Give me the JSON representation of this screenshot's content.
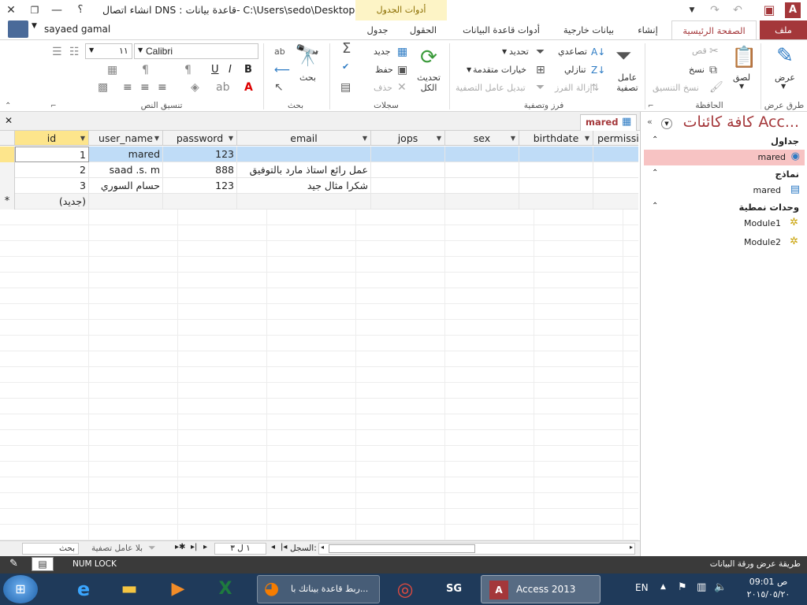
{
  "title": {
    "text": "انشاء اتصال DNS : قاعدة بيانات- C:\\Users\\sedo\\Desktop\\...",
    "help": "؟",
    "context_group": "أدوات الجدول",
    "user": "sayaed gamal"
  },
  "tabs": {
    "file": "ملف",
    "home": "الصفحة الرئيسية",
    "create": "إنشاء",
    "external": "بيانات خارجية",
    "dbtools": "أدوات قاعدة البيانات",
    "fields": "الحقول",
    "table": "جدول"
  },
  "ribbon": {
    "views": {
      "view": "عرض",
      "label": "طرق عرض"
    },
    "clipboard": {
      "paste": "لصق",
      "cut": "قص",
      "copy": "نسخ",
      "format_painter": "نسخ التنسيق",
      "label": "الحافظة"
    },
    "sort": {
      "filter": "عامل تصفية",
      "ascending": "تصاعدي",
      "descending": "تنازلي",
      "remove_sort": "إزالة الفرز",
      "selection": "تحديد",
      "advanced": "خيارات متقدمة",
      "toggle": "تبديل عامل التصفية",
      "label": "فرز وتصفية"
    },
    "records": {
      "refresh": "تحديث الكل",
      "new": "جديد",
      "save": "حفظ",
      "delete": "حذف",
      "label": "سجلات"
    },
    "find": {
      "find": "بحث",
      "label": "بحث"
    },
    "text": {
      "font": "Calibri",
      "size": "١١",
      "bold": "B",
      "italic": "I",
      "underline": "U",
      "label": "تنسيق النص"
    }
  },
  "doc_tab": "mared",
  "table": {
    "columns": [
      "id",
      "user_name",
      "password",
      "email",
      "jops",
      "sex",
      "birthdate",
      "permissi"
    ],
    "rows": [
      {
        "id": "1",
        "user_name": "mared",
        "password": "123",
        "email": ""
      },
      {
        "id": "2",
        "user_name": "saad .s. m",
        "password": "888",
        "email": "عمل رائع استاذ مارد بالتوفيق"
      },
      {
        "id": "3",
        "user_name": "حسام السوري",
        "password": "123",
        "email": "شكرا مثال جيد"
      }
    ],
    "new_row": "(جديد)",
    "new_marker": "*"
  },
  "navbar": {
    "record_label": "السجل:",
    "record_value": "١ ل ٣",
    "filter": "بلا عامل تصفية",
    "search": "بحث"
  },
  "navpane": {
    "title": "كافة كائنات Acc...",
    "tables_header": "جداول",
    "table_item": "mared",
    "forms_header": "نماذج",
    "form_item": "mared",
    "modules_header": "وحدات نمطية",
    "module1": "Module1",
    "module2": "Module2"
  },
  "status": {
    "left": "طريقة عرض ورقة البيانات",
    "numlock": "NUM LOCK"
  },
  "taskbar": {
    "firefox": "ربط قاعدة بيناتك با...",
    "access": "Access 2013",
    "lang": "EN",
    "time": "09:01 ص",
    "date": "٢٠١٥/٠٥/٢٠"
  }
}
